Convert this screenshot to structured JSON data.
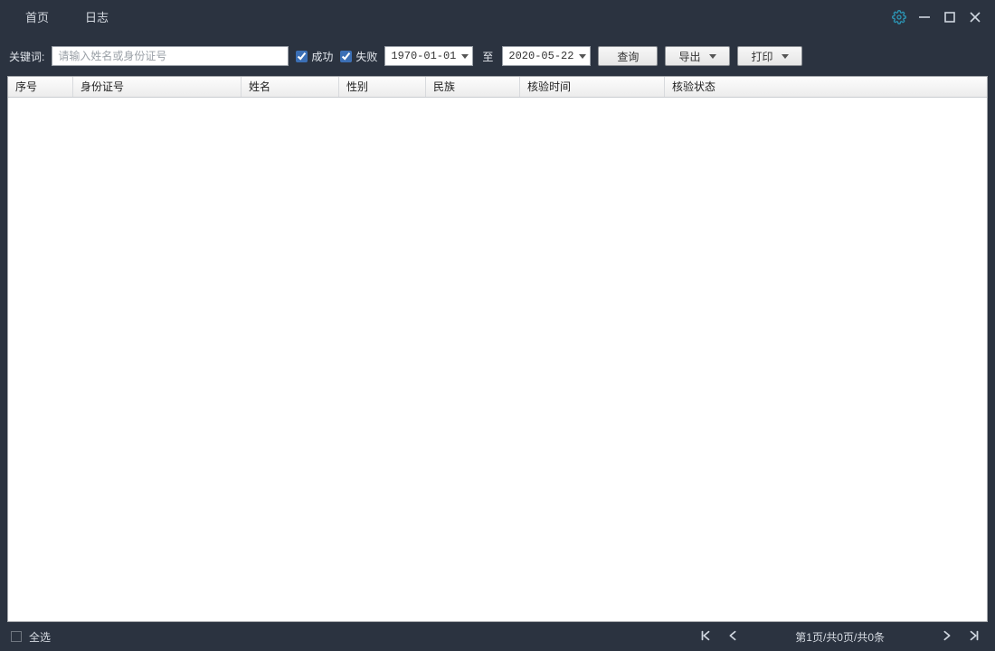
{
  "titlebar": {
    "tab_home": "首页",
    "tab_log": "日志"
  },
  "filters": {
    "keyword_label": "关键词:",
    "keyword_placeholder": "请输入姓名或身份证号",
    "success_label": "成功",
    "failure_label": "失败",
    "date_from": "1970-01-01",
    "date_to_label": "至",
    "date_to": "2020-05-22",
    "query_btn": "查询",
    "export_btn": "导出",
    "print_btn": "打印"
  },
  "table": {
    "columns": {
      "seq": "序号",
      "idcard": "身份证号",
      "name": "姓名",
      "gender": "性别",
      "ethnicity": "民族",
      "verify_time": "核验时间",
      "verify_status": "核验状态"
    }
  },
  "footer": {
    "select_all": "全选",
    "page_info": "第1页/共0页/共0条"
  }
}
